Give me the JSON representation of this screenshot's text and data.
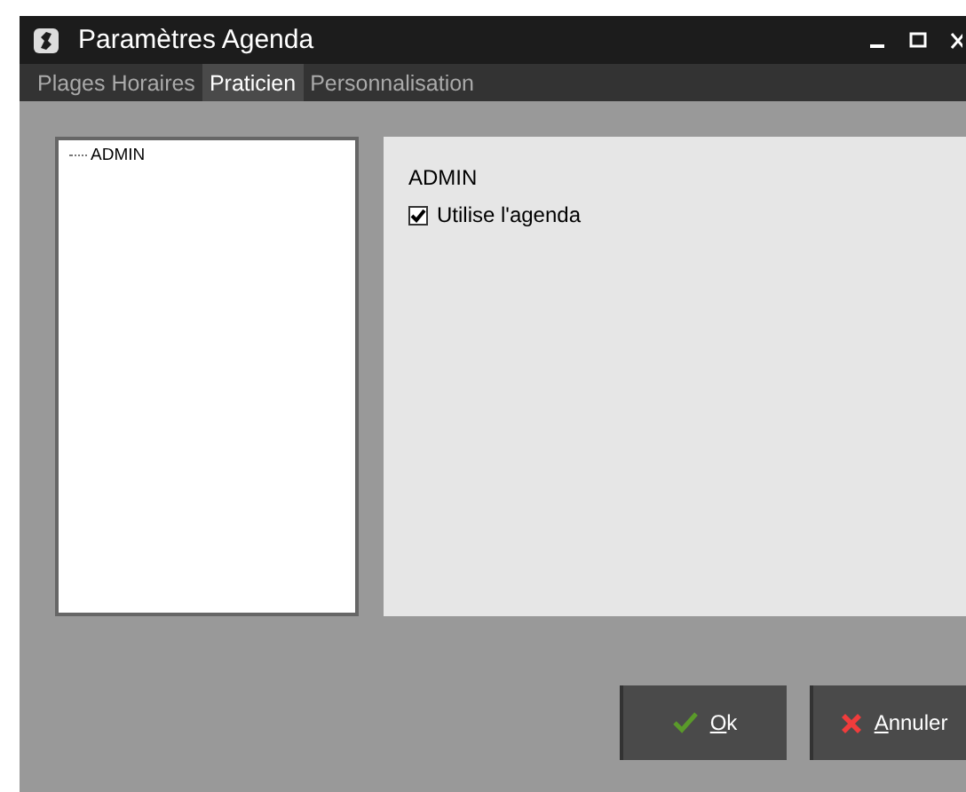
{
  "window": {
    "title": "Paramètres Agenda"
  },
  "tabs": [
    {
      "label": "Plages Horaires",
      "selected": false
    },
    {
      "label": "Praticien",
      "selected": true
    },
    {
      "label": "Personnalisation",
      "selected": false
    }
  ],
  "tree": {
    "items": [
      {
        "label": "ADMIN",
        "selected": false
      }
    ]
  },
  "details": {
    "name": "ADMIN",
    "option": {
      "label": "Utilise l'agenda",
      "checked": true
    }
  },
  "buttons": [
    {
      "kind": "ok",
      "label": "Ok"
    },
    {
      "kind": "cancel",
      "label": "Annuler"
    }
  ]
}
